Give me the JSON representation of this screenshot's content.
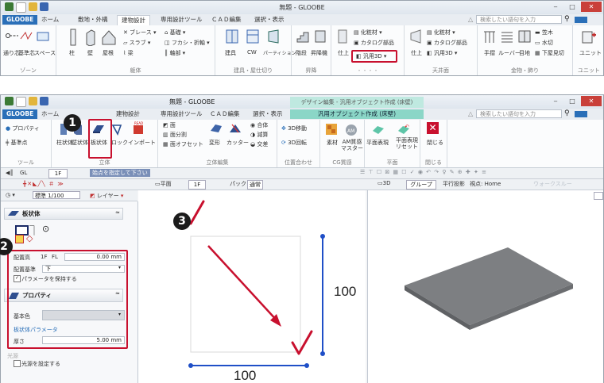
{
  "top_window": {
    "title": "無題 - GLOOBE",
    "tabs": [
      "GLOOBE",
      "ホーム",
      "敷地・外構",
      "建物設計",
      "専用設計ツール",
      "ＣＡＤ編集",
      "選択・表示"
    ],
    "search_placeholder": "検索したい語句を入力",
    "groups": {
      "zone": {
        "label": "ゾーン",
        "items": [
          "通り芯",
          "基準芯",
          "スペース"
        ]
      },
      "structure": {
        "label": "躯体",
        "items": [
          "柱",
          "壁",
          "屋根",
          "スラブ",
          "ブレース",
          "基礎",
          "フカシ・折軸",
          "梁",
          "軸部"
        ]
      },
      "fittings": {
        "label": "建具・屋仕切り",
        "items": [
          "建具",
          "CW",
          "パーティション"
        ]
      },
      "stairs": {
        "label": "昇降",
        "items": [
          "階段",
          "昇降機"
        ]
      },
      "finish": {
        "label": "仕上",
        "items": [
          "仕上",
          "化粧材",
          "カタログ部品",
          "汎用3D"
        ]
      },
      "ceiling": {
        "label": "天井面",
        "items": [
          "仕上",
          "化粧材",
          "カタログ部品",
          "汎用3D"
        ]
      },
      "hardware": {
        "label": "金物・飾り",
        "items": [
          "手摺",
          "ルーバー",
          "目地",
          "笠木",
          "水切",
          "下屋見切"
        ]
      },
      "unit": {
        "label": "ユニット",
        "items": [
          "ユニット"
        ]
      }
    }
  },
  "bottom_window": {
    "title": "無題 - GLOOBE",
    "context_title": "デザイン編集 - 汎用オブジェクト作成 (床壁)",
    "context_tab": "汎用オブジェクト作成 (床壁)",
    "tabs": [
      "GLOOBE",
      "ホーム",
      "建物設計",
      "専用設計ツール",
      "ＣＡＤ編集",
      "選択・表示"
    ],
    "search_placeholder": "検索したい語句を入力",
    "ribbon": {
      "tool": {
        "label": "ツール",
        "items": [
          "プロパティ",
          "基準点"
        ]
      },
      "solid": {
        "label": "立体",
        "items": [
          "柱状体",
          "壁状体",
          "板状体",
          "ロック",
          "インポート"
        ]
      },
      "solid_edit": {
        "label": "立体編集",
        "items": [
          "面",
          "面分割",
          "面オフセット",
          "変形",
          "カッター",
          "合体",
          "減算",
          "交差"
        ]
      },
      "align": {
        "label": "位置合わせ",
        "items": [
          "3D移動",
          "3D回転"
        ]
      },
      "cg": {
        "label": "CG質感",
        "items": [
          "素材",
          "AM質感マスター"
        ]
      },
      "plane": {
        "label": "平面",
        "items": [
          "平面表現",
          "平面表現リセット"
        ]
      },
      "close": {
        "label": "閉じる",
        "items": [
          "閉じる"
        ]
      }
    },
    "toolbar1": {
      "floor": "1F",
      "prompt": "始点を指定して下さい"
    },
    "toolbar2": {
      "scale": "標準 1/100",
      "layer": "レイヤー"
    },
    "plan_view": {
      "label": "平面",
      "floor": "1F",
      "mode": "パック",
      "status": "通常"
    },
    "view3d": {
      "label": "3D",
      "group": "グループ",
      "projection": "平行投影",
      "viewpoint": "視点: Home",
      "extra": "ウォークスルー"
    },
    "panel": {
      "section_shape": "板状体",
      "placement_height_label": "配置高",
      "placement_floor": "1F",
      "placement_fl": "FL",
      "placement_value": "0.00",
      "placement_unit": "mm",
      "placement_base_label": "配置基準",
      "placement_base_value": "下",
      "keep_params": "パラメータを保持する",
      "section_property": "プロパティ",
      "base_color_label": "基本色",
      "plate_params_label": "板状体パラメータ",
      "thickness_label": "厚さ",
      "thickness_value": "5.00",
      "thickness_unit": "mm",
      "light_section": "光源",
      "light_setting": "光源を設定する"
    },
    "dims": {
      "vertical": "100",
      "horizontal": "100"
    }
  },
  "callouts": [
    "1",
    "2",
    "3"
  ],
  "colors": {
    "accent": "#c8102e",
    "blue": "#1f4fc7",
    "app_tab": "#2a6fb8",
    "context": "#7ccfc0",
    "slab": "#7d7f82"
  }
}
